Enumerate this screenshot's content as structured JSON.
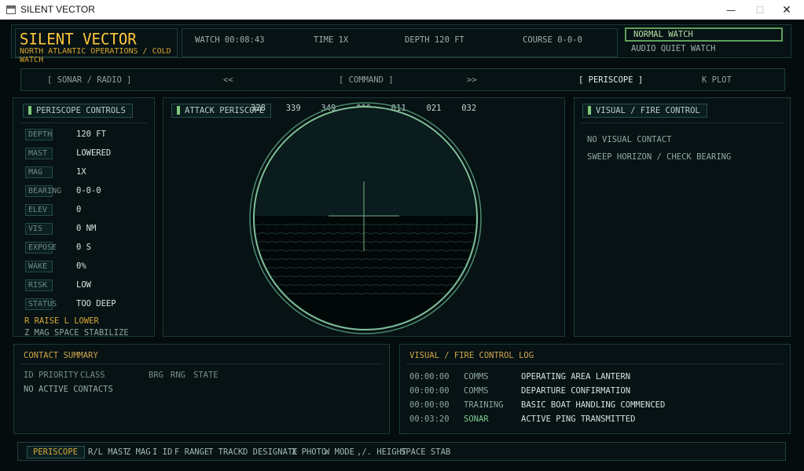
{
  "window": {
    "title": "SILENT VECTOR",
    "controls": {
      "minimize": "—",
      "maximize": "☐",
      "close": "✕"
    }
  },
  "header": {
    "title": "SILENT VECTOR",
    "subtitle": "NORTH ATLANTIC OPERATIONS / COLD WATCH",
    "watch": "WATCH 00:08:43",
    "time": "TIME 1X",
    "depth": "DEPTH 120 FT",
    "course": "COURSE 0-0-0",
    "watch_mode": "NORMAL WATCH",
    "audio_mode": "AUDIO QUIET WATCH"
  },
  "nav": {
    "sonar": "[ SONAR / RADIO ]",
    "prev": "<<",
    "command": "[ COMMAND ]",
    "next": ">>",
    "periscope": "[ PERISCOPE ]",
    "kplot": "K PLOT"
  },
  "periscope_controls": {
    "title": "PERISCOPE CONTROLS",
    "rows": [
      {
        "key": "DEPTH",
        "value": "120 FT"
      },
      {
        "key": "MAST",
        "value": "LOWERED"
      },
      {
        "key": "MAG",
        "value": "1X"
      },
      {
        "key": "BEARING",
        "value": "0-0-0"
      },
      {
        "key": "ELEV",
        "value": "0"
      },
      {
        "key": "VIS",
        "value": "0 NM"
      },
      {
        "key": "EXPOSE",
        "value": "0 S"
      },
      {
        "key": "WAKE",
        "value": "0%"
      },
      {
        "key": "RISK",
        "value": "LOW"
      },
      {
        "key": "STATUS",
        "value": "TOO DEEP"
      }
    ],
    "hint1": "R RAISE  L LOWER",
    "hint2": "Z MAG  SPACE STABILIZE"
  },
  "attack_periscope": {
    "title": "ATTACK PERISCOPE",
    "bearings": [
      "328",
      "339",
      "349",
      "000",
      "011",
      "021",
      "032"
    ]
  },
  "visual_fire": {
    "title": "VISUAL / FIRE CONTROL",
    "line1": "NO VISUAL CONTACT",
    "line2": "SWEEP HORIZON / CHECK BEARING"
  },
  "contact_summary": {
    "title": "CONTACT SUMMARY",
    "columns": [
      "ID",
      "PRIORITY",
      "CLASS",
      "BRG",
      "RNG",
      "STATE"
    ],
    "empty": "NO ACTIVE CONTACTS"
  },
  "fire_log": {
    "title": "VISUAL / FIRE CONTROL LOG",
    "entries": [
      {
        "time": "00:00:00",
        "source": "COMMS",
        "message": "OPERATING AREA LANTERN"
      },
      {
        "time": "00:00:00",
        "source": "COMMS",
        "message": "DEPARTURE CONFIRMATION"
      },
      {
        "time": "00:00:00",
        "source": "TRAINING",
        "message": "BASIC BOAT HANDLING COMMENCED"
      },
      {
        "time": "00:03:20",
        "source": "SONAR",
        "message": "ACTIVE PING TRANSMITTED"
      }
    ]
  },
  "footer": {
    "mode": "PERISCOPE",
    "keys": [
      "R/L MAST",
      "Z MAG",
      "I ID",
      "F RANGE",
      "T TRACK",
      "D DESIGNATE",
      "X PHOTO",
      "W MODE",
      ",/. HEIGHT",
      "SPACE STAB"
    ]
  },
  "colors": {
    "amber": "#ffc83a",
    "green_accent": "#7ecb7a",
    "scope_ring": "#6fae8c",
    "sonar_source": "#7ec98e",
    "background": "#040c0e"
  }
}
